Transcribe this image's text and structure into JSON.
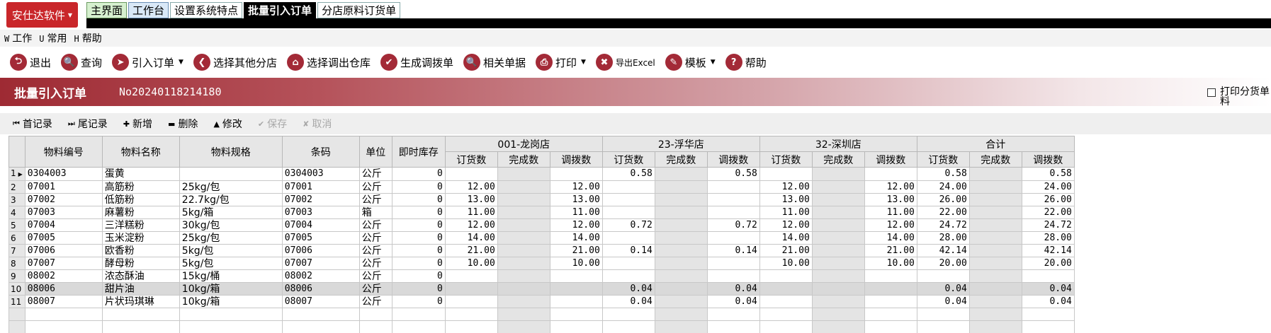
{
  "app": {
    "brand": "安仕达软件"
  },
  "tabs": [
    {
      "label": "主界面",
      "style": "green"
    },
    {
      "label": "工作台",
      "style": "blue"
    },
    {
      "label": "设置系统特点",
      "style": "plain"
    },
    {
      "label": "批量引入订单",
      "style": "active"
    },
    {
      "label": "分店原料订货单",
      "style": "plain"
    }
  ],
  "menu": [
    {
      "key": "W",
      "label": "工作"
    },
    {
      "key": "U",
      "label": "常用"
    },
    {
      "key": "H",
      "label": "帮助"
    }
  ],
  "toolbar": [
    {
      "label": "退出",
      "icon": "exit-icon",
      "glyph": "⮌",
      "dropdown": false
    },
    {
      "label": "查询",
      "icon": "search-icon",
      "glyph": "🔍",
      "dropdown": false
    },
    {
      "label": "引入订单",
      "icon": "import-icon",
      "glyph": "➤",
      "dropdown": true
    },
    {
      "label": "选择其他分店",
      "icon": "branch-icon",
      "glyph": "❮",
      "dropdown": false
    },
    {
      "label": "选择调出仓库",
      "icon": "warehouse-icon",
      "glyph": "⌂",
      "dropdown": false
    },
    {
      "label": "生成调拨单",
      "icon": "check-icon",
      "glyph": "✔",
      "dropdown": false
    },
    {
      "label": "相关单据",
      "icon": "documents-icon",
      "glyph": "🔍",
      "dropdown": false
    },
    {
      "label": "打印",
      "icon": "print-icon",
      "glyph": "⎙",
      "dropdown": true
    },
    {
      "label": "导出Excel",
      "icon": "excel-icon",
      "glyph": "✖",
      "dropdown": false
    },
    {
      "label": "模板",
      "icon": "template-icon",
      "glyph": "✎",
      "dropdown": true
    },
    {
      "label": "帮助",
      "icon": "help-icon",
      "glyph": "?",
      "dropdown": false
    }
  ],
  "header": {
    "title": "批量引入订单",
    "doc_no": "No20240118214180",
    "print_option": "打印分货单\n料"
  },
  "recbar": [
    {
      "label": "首记录",
      "sym": "⏮",
      "enabled": true
    },
    {
      "label": "尾记录",
      "sym": "⏭",
      "enabled": true
    },
    {
      "label": "新增",
      "sym": "✚",
      "enabled": true
    },
    {
      "label": "删除",
      "sym": "▬",
      "enabled": true
    },
    {
      "label": "修改",
      "sym": "▲",
      "enabled": true
    },
    {
      "label": "保存",
      "sym": "✔",
      "enabled": false
    },
    {
      "label": "取消",
      "sym": "✘",
      "enabled": false
    }
  ],
  "grid": {
    "fixed_headers": [
      "物料编号",
      "物料名称",
      "物料规格",
      "条码",
      "单位",
      "即时库存"
    ],
    "groups": [
      "001-龙岗店",
      "23-浮华店",
      "32-深圳店",
      "合计"
    ],
    "sub_headers": [
      "订货数",
      "完成数",
      "调拨数"
    ],
    "rows": [
      {
        "n": "1",
        "code": "0304003",
        "name": "蛋黄",
        "spec": "",
        "barcode": "0304003",
        "unit": "公斤",
        "stock": "0",
        "v": [
          "",
          "",
          "",
          "0.58",
          "",
          "0.58",
          "",
          "",
          "",
          "0.58",
          "",
          "0.58"
        ]
      },
      {
        "n": "2",
        "code": "07001",
        "name": "高筋粉",
        "spec": "25kg/包",
        "barcode": "07001",
        "unit": "公斤",
        "stock": "0",
        "v": [
          "12.00",
          "",
          "12.00",
          "",
          "",
          "",
          "12.00",
          "",
          "12.00",
          "24.00",
          "",
          "24.00"
        ]
      },
      {
        "n": "3",
        "code": "07002",
        "name": "低筋粉",
        "spec": "22.7kg/包",
        "barcode": "07002",
        "unit": "公斤",
        "stock": "0",
        "v": [
          "13.00",
          "",
          "13.00",
          "",
          "",
          "",
          "13.00",
          "",
          "13.00",
          "26.00",
          "",
          "26.00"
        ]
      },
      {
        "n": "4",
        "code": "07003",
        "name": "麻薯粉",
        "spec": "5kg/箱",
        "barcode": "07003",
        "unit": "箱",
        "stock": "0",
        "v": [
          "11.00",
          "",
          "11.00",
          "",
          "",
          "",
          "11.00",
          "",
          "11.00",
          "22.00",
          "",
          "22.00"
        ]
      },
      {
        "n": "5",
        "code": "07004",
        "name": "三洋糕粉",
        "spec": "30kg/包",
        "barcode": "07004",
        "unit": "公斤",
        "stock": "0",
        "v": [
          "12.00",
          "",
          "12.00",
          "0.72",
          "",
          "0.72",
          "12.00",
          "",
          "12.00",
          "24.72",
          "",
          "24.72"
        ]
      },
      {
        "n": "6",
        "code": "07005",
        "name": "玉米淀粉",
        "spec": "25kg/包",
        "barcode": "07005",
        "unit": "公斤",
        "stock": "0",
        "v": [
          "14.00",
          "",
          "14.00",
          "",
          "",
          "",
          "14.00",
          "",
          "14.00",
          "28.00",
          "",
          "28.00"
        ]
      },
      {
        "n": "7",
        "code": "07006",
        "name": "欧香粉",
        "spec": "5kg/包",
        "barcode": "07006",
        "unit": "公斤",
        "stock": "0",
        "v": [
          "21.00",
          "",
          "21.00",
          "0.14",
          "",
          "0.14",
          "21.00",
          "",
          "21.00",
          "42.14",
          "",
          "42.14"
        ]
      },
      {
        "n": "8",
        "code": "07007",
        "name": "酵母粉",
        "spec": "5kg/包",
        "barcode": "07007",
        "unit": "公斤",
        "stock": "0",
        "v": [
          "10.00",
          "",
          "10.00",
          "",
          "",
          "",
          "10.00",
          "",
          "10.00",
          "20.00",
          "",
          "20.00"
        ]
      },
      {
        "n": "9",
        "code": "08002",
        "name": "浓态酥油",
        "spec": "15kg/桶",
        "barcode": "08002",
        "unit": "公斤",
        "stock": "0",
        "v": [
          "",
          "",
          "",
          "",
          "",
          "",
          "",
          "",
          "",
          "",
          "",
          ""
        ]
      },
      {
        "n": "10",
        "code": "08006",
        "name": "甜片油",
        "spec": "10kg/箱",
        "barcode": "08006",
        "unit": "公斤",
        "stock": "0",
        "v": [
          "",
          "",
          "",
          "0.04",
          "",
          "0.04",
          "",
          "",
          "",
          "0.04",
          "",
          "0.04"
        ]
      },
      {
        "n": "11",
        "code": "08007",
        "name": "片状玛琪琳",
        "spec": "10kg/箱",
        "barcode": "08007",
        "unit": "公斤",
        "stock": "0",
        "v": [
          "",
          "",
          "",
          "0.04",
          "",
          "0.04",
          "",
          "",
          "",
          "0.04",
          "",
          "0.04"
        ]
      }
    ],
    "current_row_marker": "▶"
  }
}
